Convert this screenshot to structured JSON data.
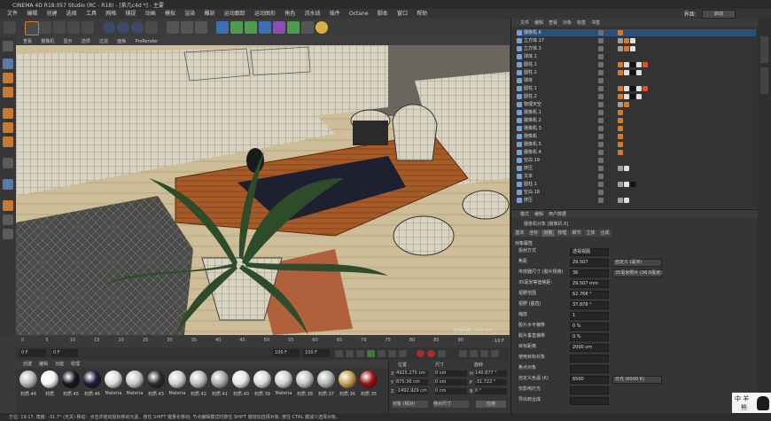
{
  "window": {
    "title": "CINEMA 4D R18.057 Studio (RC - R18) - [茶几c4d *] - 主要"
  },
  "menubar": {
    "items": [
      "文件",
      "编辑",
      "创建",
      "选择",
      "工具",
      "网格",
      "捕捉",
      "动画",
      "模拟",
      "渲染",
      "雕刻",
      "运动跟踪",
      "运动图形",
      "角色",
      "流水线",
      "插件",
      "Octane",
      "脚本",
      "窗口",
      "帮助"
    ],
    "layout_label": "界面:",
    "layout_value": "启动"
  },
  "viewport": {
    "menu": [
      "查看",
      "摄像机",
      "显示",
      "选项",
      "过滤",
      "面板",
      "ProRender"
    ],
    "grid_label": "网格间距 : 100 cm"
  },
  "objects_panel": {
    "menu": [
      "文件",
      "编辑",
      "查看",
      "对象",
      "标签",
      "书签"
    ],
    "rows": [
      {
        "name": "摄像机.6",
        "selected": true,
        "tags": [
          "#d47b2a"
        ]
      },
      {
        "name": "立方体.17",
        "tags": [
          "#a0a0a0",
          "#d47b2a",
          "#e0e0e0"
        ]
      },
      {
        "name": "立方体.3",
        "tags": [
          "#a0a0a0",
          "#d47b2a",
          "#e0e0e0"
        ]
      },
      {
        "name": "球体.1",
        "tags": []
      },
      {
        "name": "圆柱.1",
        "tags": [
          "#d47b2a",
          "#e0e0e0",
          "#111111",
          "#e0e0e0",
          "#e05030"
        ]
      },
      {
        "name": "圆柱.2",
        "tags": [
          "#d47b2a",
          "#e0e0e0",
          "#111111",
          "#e0e0e0"
        ]
      },
      {
        "name": "球体",
        "tags": []
      },
      {
        "name": "圆柱.1",
        "tags": [
          "#d47b2a",
          "#e0e0e0",
          "#111111",
          "#e0e0e0",
          "#e05030"
        ]
      },
      {
        "name": "圆柱.2",
        "tags": [
          "#d47b2a",
          "#e0e0e0",
          "#111111",
          "#e0e0e0"
        ]
      },
      {
        "name": "物理天空",
        "tags": [
          "#a0a0a0",
          "#d47b2a"
        ]
      },
      {
        "name": "摄像机.1",
        "tags": [
          "#d47b2a"
        ]
      },
      {
        "name": "摄像机.2",
        "tags": [
          "#d47b2a"
        ]
      },
      {
        "name": "摄像机.3",
        "tags": [
          "#d47b2a"
        ]
      },
      {
        "name": "摄像机",
        "tags": [
          "#d47b2a"
        ]
      },
      {
        "name": "摄像机.5",
        "tags": [
          "#d47b2a"
        ]
      },
      {
        "name": "摄像机.4",
        "tags": [
          "#d47b2a"
        ]
      },
      {
        "name": "空白.19",
        "tags": []
      },
      {
        "name": "挤压",
        "tags": [
          "#a0a0a0",
          "#e0e0e0"
        ]
      },
      {
        "name": "文本",
        "tags": []
      },
      {
        "name": "圆柱.1",
        "tags": [
          "#a0a0a0",
          "#e0e0e0",
          "#111111"
        ]
      },
      {
        "name": "空白.18",
        "tags": []
      },
      {
        "name": "挤压",
        "tags": [
          "#a0a0a0",
          "#e0e0e0"
        ]
      }
    ]
  },
  "attributes_panel": {
    "menu": [
      "模式",
      "编辑",
      "用户数据"
    ],
    "object_title": "摄像机对象 [摄像机.6]",
    "tabs": [
      "基本",
      "坐标",
      "对象",
      "物理",
      "细节",
      "立体",
      "合成"
    ],
    "section": "对象属性",
    "rows": [
      {
        "label": "投射方式",
        "value": "透视视图"
      },
      {
        "label": "焦距",
        "value": "29.507",
        "extra": "自定义 (毫米)"
      },
      {
        "label": "传感器尺寸 (胶片规格)",
        "value": "36",
        "extra": "35毫米照片 (36.0毫米)"
      },
      {
        "label": "35毫米等值焦距:",
        "value": "29.507 mm"
      },
      {
        "label": "视野范围",
        "value": "62.768 °"
      },
      {
        "label": "视野 (垂直)",
        "value": "37.878 °"
      },
      {
        "label": "缩放",
        "value": "1"
      },
      {
        "label": "胶片水平偏移",
        "value": "0 %"
      },
      {
        "label": "胶片垂直偏移",
        "value": "0 %"
      },
      {
        "label": "目标距离",
        "value": "2000 cm"
      },
      {
        "label": "使用目标对象",
        "value": ""
      },
      {
        "label": "焦点对象",
        "value": ""
      },
      {
        "label": "自定义色温 (K)",
        "value": "6500",
        "extra": "日光 (6500 K)"
      },
      {
        "label": "仅影响灯光",
        "value": ""
      },
      {
        "label": "导出到合成",
        "value": ""
      }
    ]
  },
  "timeline": {
    "ticks": [
      "0",
      "5",
      "10",
      "15",
      "20",
      "25",
      "30",
      "35",
      "40",
      "45",
      "50",
      "55",
      "60",
      "65",
      "70",
      "75",
      "80",
      "85",
      "90"
    ],
    "end_label": "-10 F"
  },
  "transport": {
    "start": "0 F",
    "field2": "0 F",
    "end": "100 F",
    "field4": "100 F"
  },
  "materials": {
    "menu": [
      "创建",
      "编辑",
      "功能",
      "纹理"
    ],
    "items": [
      {
        "label": "材质.44",
        "color": "#b8b8b8"
      },
      {
        "label": "材质",
        "color": "#f4f4f4"
      },
      {
        "label": "材质.45",
        "color": "#151525"
      },
      {
        "label": "材质.46",
        "color": "#1a1a3a"
      },
      {
        "label": "Materia",
        "color": "#dcdcdc"
      },
      {
        "label": "Materia",
        "color": "#c8c8c8"
      },
      {
        "label": "材质.43",
        "color": "#2a2a2a"
      },
      {
        "label": "Materia",
        "color": "#d0d0d0"
      },
      {
        "label": "材质.42",
        "color": "#bfbfbf"
      },
      {
        "label": "材质.41",
        "color": "#aaaaaa"
      },
      {
        "label": "材质.40",
        "color": "#e6e6e6"
      },
      {
        "label": "材质.39",
        "color": "#d8d8d8"
      },
      {
        "label": "Materia",
        "color": "#cfcfcf"
      },
      {
        "label": "材质.38",
        "color": "#c2c2c2"
      },
      {
        "label": "材质.37",
        "color": "#b5b5b5"
      },
      {
        "label": "材质.36",
        "color": "#c9a050"
      },
      {
        "label": "材质.35",
        "color": "#9a1010"
      }
    ]
  },
  "coords": {
    "headers": [
      "位置",
      "尺寸",
      "旋转"
    ],
    "rows": [
      {
        "axis": "X",
        "pos": "4925.275 cm",
        "size": "0 cm",
        "rot_label": "H",
        "rot": "140.877 °"
      },
      {
        "axis": "Y",
        "pos": "875.36 cm",
        "size": "0 cm",
        "rot_label": "P",
        "rot": "-31.722 °"
      },
      {
        "axis": "Z",
        "pos": "-1492.929 cm",
        "size": "0 cm",
        "rot_label": "B",
        "rot": "0 °"
      }
    ],
    "mode1": "对象 (相对)",
    "mode2": "绝对尺寸",
    "apply": "应用"
  },
  "statusbar": {
    "text": "方位: 19.17, 角度: -31.7° (无关) 移动：点击并拖动鼠标移动元素。按住 SHIFT 键量化移动; 节点编辑模式时按住 SHIFT 键增加选择对象; 按住 CTRL 键减少选择对象。"
  },
  "watermark": {
    "line1": "中 羊",
    "line2": "熊"
  },
  "colors": {
    "accent": "#d47b2a",
    "selection": "#2c4f7a",
    "viewport_bg": "#4c4c4c"
  }
}
